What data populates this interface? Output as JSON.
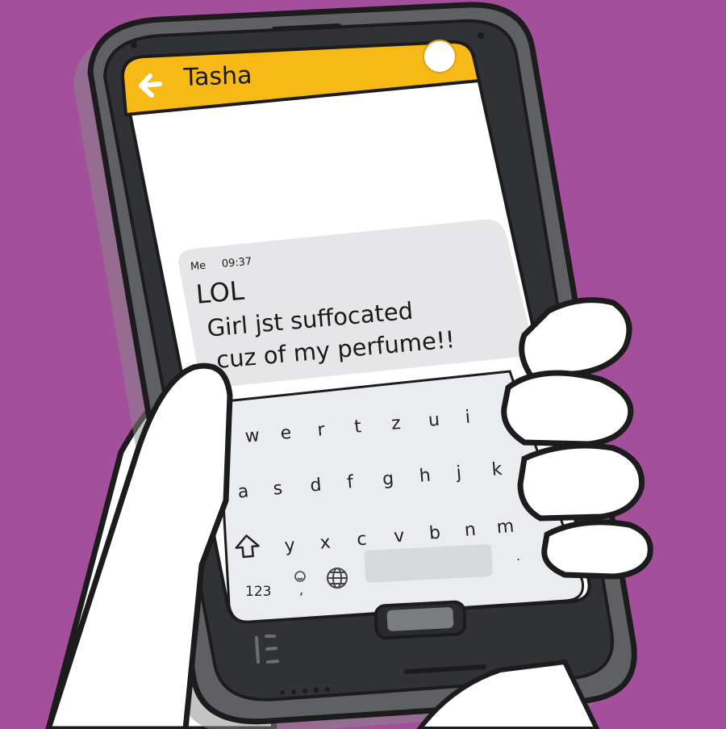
{
  "header": {
    "back_icon": "arrow-left-icon",
    "contact_name": "Tasha",
    "avatar_icon": "avatar-circle",
    "bar_color": "#f7b916"
  },
  "message": {
    "sender": "Me",
    "time": "09:37",
    "lines": [
      "LOL",
      "Girl jst suffocated",
      "cuz of my perfume!!"
    ],
    "bubble_color": "#e6e6e8"
  },
  "keyboard": {
    "row1": [
      "w",
      "e",
      "r",
      "t",
      "z",
      "u",
      "i"
    ],
    "row2": [
      "a",
      "s",
      "d",
      "f",
      "g",
      "h",
      "j",
      "k"
    ],
    "row3": [
      "y",
      "x",
      "c",
      "v",
      "b",
      "n",
      "m"
    ],
    "shift_icon": "shift-arrow-icon",
    "numbers_label": "123",
    "emoji_icon": "smiley-icon",
    "comma_label": ",",
    "globe_icon": "globe-icon",
    "period_label": ".",
    "background_color": "#eaecf0"
  },
  "background_color": "#a34f9c"
}
